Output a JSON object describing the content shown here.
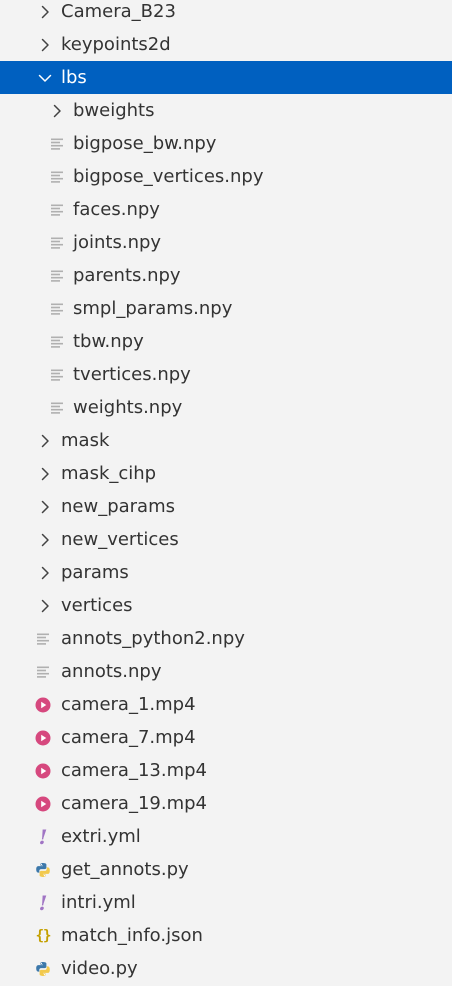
{
  "explorer": {
    "items": [
      {
        "label": "Camera_B23",
        "kind": "folder",
        "depth": 1,
        "expanded": false,
        "selected": false
      },
      {
        "label": "keypoints2d",
        "kind": "folder",
        "depth": 1,
        "expanded": false,
        "selected": false
      },
      {
        "label": "lbs",
        "kind": "folder",
        "depth": 1,
        "expanded": true,
        "selected": true
      },
      {
        "label": "bweights",
        "kind": "folder",
        "depth": 2,
        "expanded": false,
        "selected": false
      },
      {
        "label": "bigpose_bw.npy",
        "kind": "file",
        "depth": 2,
        "icon": "lines-file-icon"
      },
      {
        "label": "bigpose_vertices.npy",
        "kind": "file",
        "depth": 2,
        "icon": "lines-file-icon"
      },
      {
        "label": "faces.npy",
        "kind": "file",
        "depth": 2,
        "icon": "lines-file-icon"
      },
      {
        "label": "joints.npy",
        "kind": "file",
        "depth": 2,
        "icon": "lines-file-icon"
      },
      {
        "label": "parents.npy",
        "kind": "file",
        "depth": 2,
        "icon": "lines-file-icon"
      },
      {
        "label": "smpl_params.npy",
        "kind": "file",
        "depth": 2,
        "icon": "lines-file-icon"
      },
      {
        "label": "tbw.npy",
        "kind": "file",
        "depth": 2,
        "icon": "lines-file-icon"
      },
      {
        "label": "tvertices.npy",
        "kind": "file",
        "depth": 2,
        "icon": "lines-file-icon"
      },
      {
        "label": "weights.npy",
        "kind": "file",
        "depth": 2,
        "icon": "lines-file-icon"
      },
      {
        "label": "mask",
        "kind": "folder",
        "depth": 1,
        "expanded": false,
        "selected": false
      },
      {
        "label": "mask_cihp",
        "kind": "folder",
        "depth": 1,
        "expanded": false,
        "selected": false
      },
      {
        "label": "new_params",
        "kind": "folder",
        "depth": 1,
        "expanded": false,
        "selected": false
      },
      {
        "label": "new_vertices",
        "kind": "folder",
        "depth": 1,
        "expanded": false,
        "selected": false
      },
      {
        "label": "params",
        "kind": "folder",
        "depth": 1,
        "expanded": false,
        "selected": false
      },
      {
        "label": "vertices",
        "kind": "folder",
        "depth": 1,
        "expanded": false,
        "selected": false
      },
      {
        "label": "annots_python2.npy",
        "kind": "file",
        "depth": 1,
        "icon": "lines-file-icon"
      },
      {
        "label": "annots.npy",
        "kind": "file",
        "depth": 1,
        "icon": "lines-file-icon"
      },
      {
        "label": "camera_1.mp4",
        "kind": "file",
        "depth": 1,
        "icon": "video-file-icon"
      },
      {
        "label": "camera_7.mp4",
        "kind": "file",
        "depth": 1,
        "icon": "video-file-icon"
      },
      {
        "label": "camera_13.mp4",
        "kind": "file",
        "depth": 1,
        "icon": "video-file-icon"
      },
      {
        "label": "camera_19.mp4",
        "kind": "file",
        "depth": 1,
        "icon": "video-file-icon"
      },
      {
        "label": "extri.yml",
        "kind": "file",
        "depth": 1,
        "icon": "yaml-file-icon"
      },
      {
        "label": "get_annots.py",
        "kind": "file",
        "depth": 1,
        "icon": "python-file-icon"
      },
      {
        "label": "intri.yml",
        "kind": "file",
        "depth": 1,
        "icon": "yaml-file-icon"
      },
      {
        "label": "match_info.json",
        "kind": "file",
        "depth": 1,
        "icon": "json-file-icon"
      },
      {
        "label": "video.py",
        "kind": "file",
        "depth": 1,
        "icon": "python-file-icon"
      }
    ]
  },
  "colors": {
    "background": "#f3f3f3",
    "text": "#333333",
    "selected_background": "#0060c0",
    "selected_text": "#ffffff",
    "chevron": "#424242",
    "generic_file_icon": "#b0b0b0",
    "video_icon": "#d6487e",
    "yaml_icon": "#a074c4",
    "python_icon_blue": "#3c78aa",
    "python_icon_yellow": "#f2c94c",
    "json_icon": "#c4a000"
  }
}
